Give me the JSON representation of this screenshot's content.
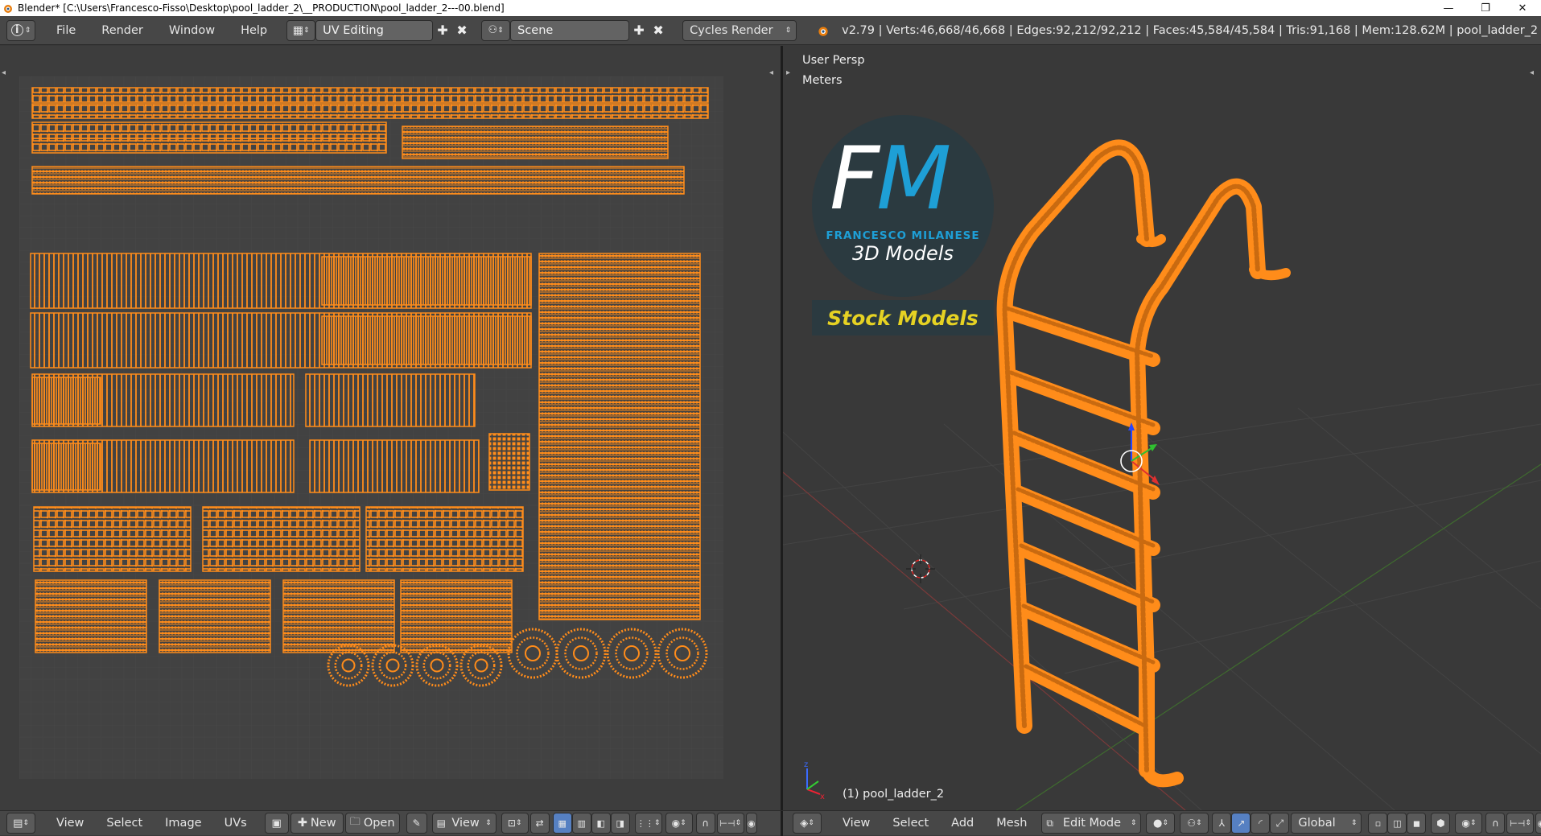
{
  "titlebar": {
    "title": "Blender* [C:\\Users\\Francesco-Fisso\\Desktop\\pool_ladder_2\\__PRODUCTION\\pool_ladder_2---00.blend]",
    "minimize": "—",
    "maximize": "❐",
    "close": "✕"
  },
  "infobar": {
    "menus": [
      "File",
      "Render",
      "Window",
      "Help"
    ],
    "screen_layout": "UV Editing",
    "scene": "Scene",
    "render_engine": "Cycles Render",
    "stats": "v2.79 | Verts:46,668/46,668 | Edges:92,212/92,212 | Faces:45,584/45,584 | Tris:91,168 | Mem:128.62M | pool_ladder_2"
  },
  "uv_editor": {
    "menus": [
      "View",
      "Select",
      "Image",
      "UVs"
    ],
    "new_label": "New",
    "open_label": "Open",
    "view_label": "View"
  },
  "viewport": {
    "view_name": "User Persp",
    "units": "Meters",
    "object_label": "(1) pool_ladder_2",
    "menus": [
      "View",
      "Select",
      "Add",
      "Mesh"
    ],
    "mode": "Edit Mode",
    "orientation": "Global"
  },
  "watermark": {
    "monogram": "FM",
    "author": "FRANCESCO MILANESE",
    "subtitle": "3D Models",
    "banner": "Stock Models"
  },
  "colors": {
    "uv_orange": "#ff8c1a",
    "header_bg": "#474747",
    "uv_bg": "#3d3d3d",
    "viewport_bg": "#393939",
    "fm_blue": "#1e9fd6",
    "stock_yellow": "#e6d223"
  }
}
